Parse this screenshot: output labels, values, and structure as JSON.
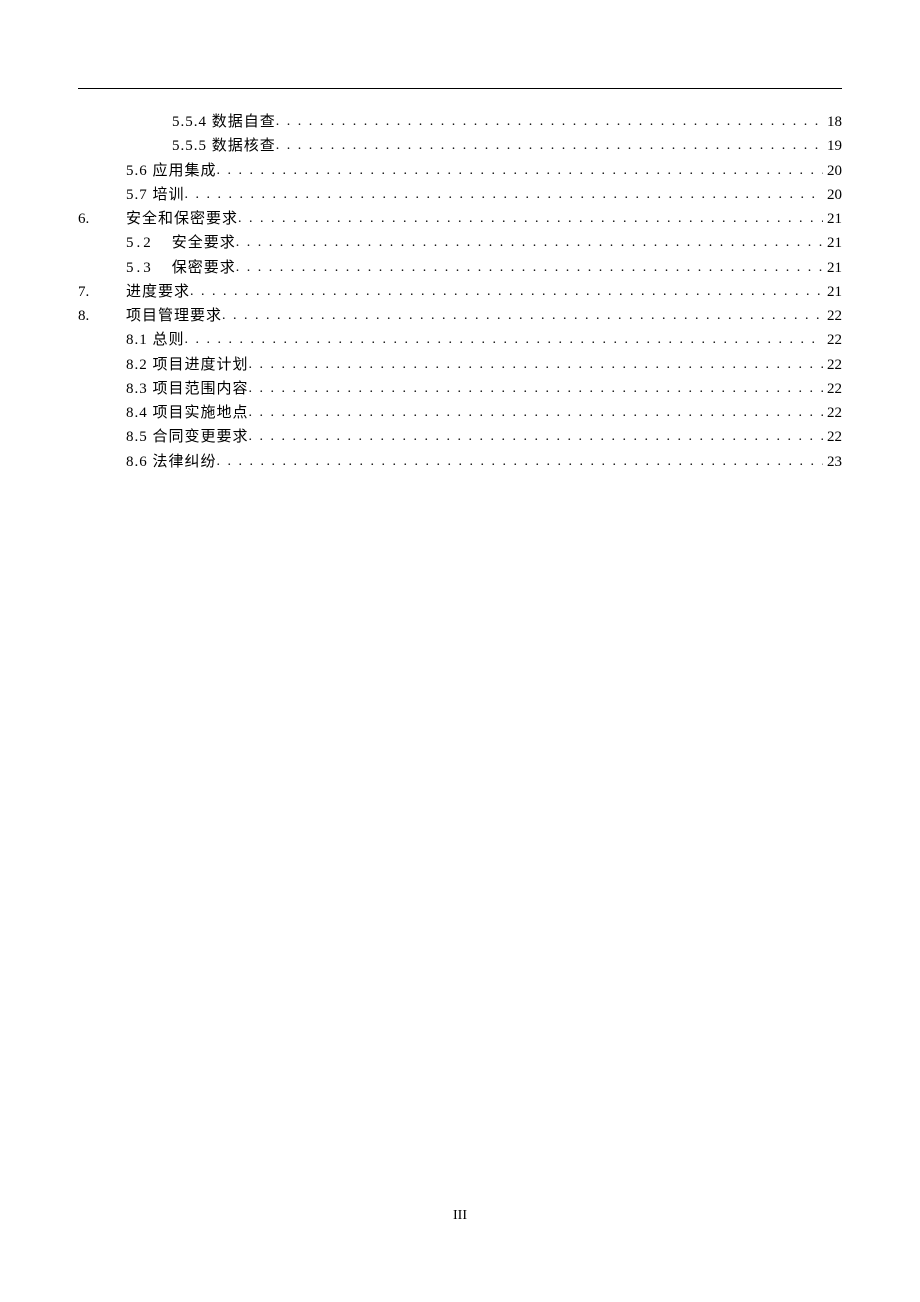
{
  "page_number": "III",
  "toc": [
    {
      "level": 2,
      "num_col": "",
      "label": "5.5.4 数据自查",
      "page": "18"
    },
    {
      "level": 2,
      "num_col": "",
      "label": "5.5.5 数据核查",
      "page": "19"
    },
    {
      "level": 1,
      "num_col": "",
      "label": "5.6 应用集成",
      "page": "20"
    },
    {
      "level": 1,
      "num_col": "",
      "label": "5.7 培训",
      "page": "20"
    },
    {
      "level": 0,
      "num_col": "6.",
      "label": "安全和保密要求",
      "page": "21"
    },
    {
      "level": 1,
      "num_col": "",
      "sub_num": "5.2",
      "label": "安全要求",
      "page": "21"
    },
    {
      "level": 1,
      "num_col": "",
      "sub_num": "5.3",
      "label": "保密要求",
      "page": "21"
    },
    {
      "level": 0,
      "num_col": "7.",
      "label": "进度要求",
      "page": "21"
    },
    {
      "level": 0,
      "num_col": "8.",
      "label": "项目管理要求",
      "page": "22"
    },
    {
      "level": 1,
      "num_col": "",
      "label": "8.1 总则",
      "page": "22"
    },
    {
      "level": 1,
      "num_col": "",
      "label": "8.2 项目进度计划",
      "page": "22"
    },
    {
      "level": 1,
      "num_col": "",
      "label": "8.3 项目范围内容",
      "page": "22"
    },
    {
      "level": 1,
      "num_col": "",
      "label": "8.4 项目实施地点",
      "page": "22"
    },
    {
      "level": 1,
      "num_col": "",
      "label": "8.5 合同变更要求",
      "page": "22"
    },
    {
      "level": 1,
      "num_col": "",
      "label": "8.6 法律纠纷",
      "page": "23"
    }
  ]
}
